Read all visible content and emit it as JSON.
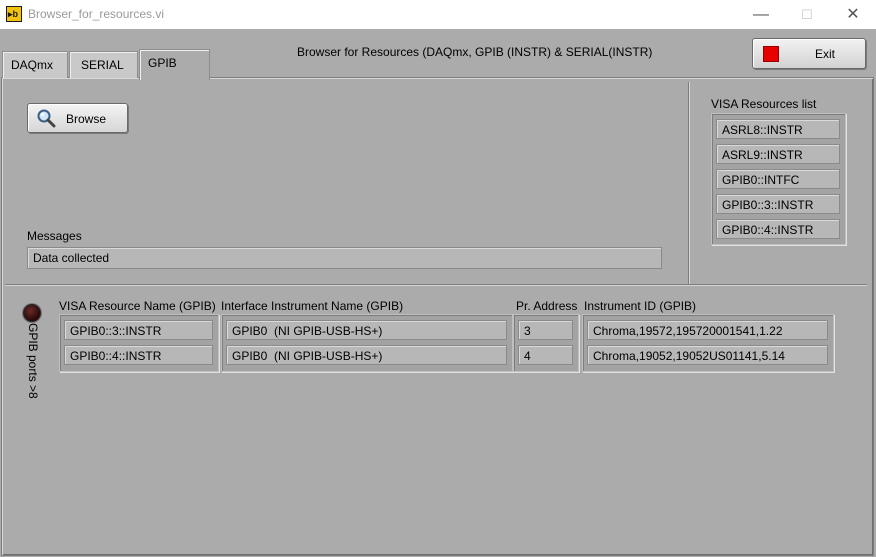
{
  "window": {
    "title": "Browser_for_resources.vi",
    "controls": {
      "minimize": "—",
      "maximize": "☐",
      "close": "✕"
    }
  },
  "tabs": [
    {
      "label": "DAQmx",
      "active": false
    },
    {
      "label": "SERIAL",
      "active": false
    },
    {
      "label": "GPIB",
      "active": true
    }
  ],
  "header": {
    "title": "Browser for Resources (DAQmx, GPIB (INSTR) & SERIAL(INSTR)"
  },
  "exit_button": {
    "label": "Exit",
    "icon": "red-square-icon",
    "icon_color": "#e60000"
  },
  "browse_button": {
    "label": "Browse",
    "icon": "magnifier-icon"
  },
  "messages": {
    "label": "Messages",
    "value": "Data collected"
  },
  "visa_resources": {
    "label": "VISA Resources list",
    "items": [
      "ASRL8::INSTR",
      "ASRL9::INSTR",
      "GPIB0::INTFC",
      "GPIB0::3::INSTR",
      "GPIB0::4::INSTR"
    ]
  },
  "led": {
    "label": "GPIB ports >8",
    "state": "off",
    "color": "#3a0c0c"
  },
  "gpib_table": {
    "columns": [
      {
        "label": "VISA Resource Name (GPIB)",
        "values": [
          "GPIB0::3::INSTR",
          "GPIB0::4::INSTR"
        ]
      },
      {
        "label": "Interface Instrument Name (GPIB)",
        "values": [
          "GPIB0  (NI GPIB-USB-HS+)",
          "GPIB0  (NI GPIB-USB-HS+)"
        ]
      },
      {
        "label": "Pr. Address",
        "values": [
          "3",
          "4"
        ]
      },
      {
        "label": "Instrument ID (GPIB)",
        "values": [
          "Chroma,19572,195720001541,1.22",
          "Chroma,19052,19052US01141,5.14"
        ]
      }
    ]
  }
}
